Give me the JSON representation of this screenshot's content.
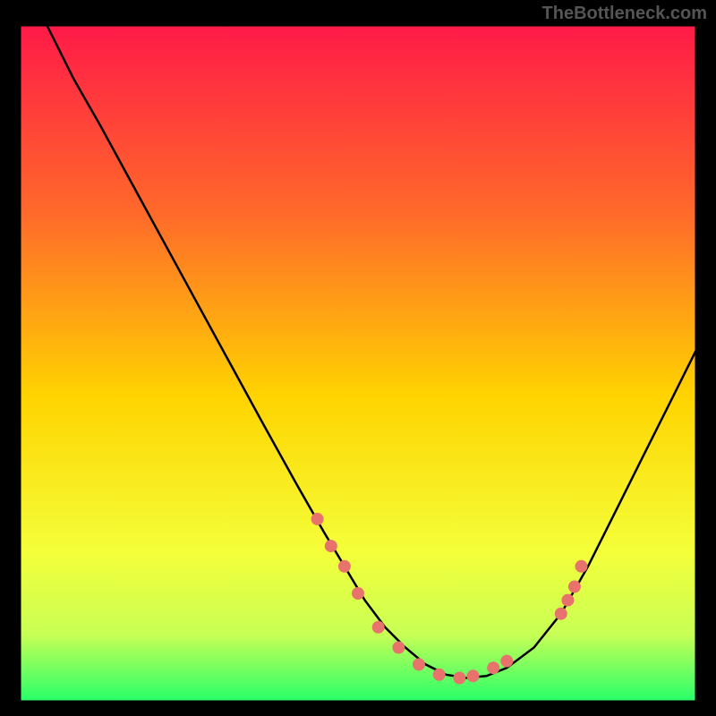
{
  "watermark": "TheBottleneck.com",
  "chart_data": {
    "type": "line",
    "title": "",
    "xlabel": "",
    "ylabel": "",
    "xlim": [
      0,
      100
    ],
    "ylim": [
      0,
      100
    ],
    "grid": false,
    "legend": false,
    "background_gradient": {
      "top": "#ff1a48",
      "mid": "#ffe600",
      "bottom": "#26ff6a"
    },
    "series": [
      {
        "name": "curve",
        "color": "#000000",
        "x": [
          4,
          5,
          8,
          12,
          18,
          24,
          30,
          36,
          41,
          45,
          48,
          51,
          54,
          57,
          60,
          63,
          66,
          69,
          72,
          76,
          80,
          84,
          88,
          92,
          96,
          100
        ],
        "y": [
          100,
          98,
          92,
          85,
          74,
          63,
          52,
          41,
          32,
          25,
          20,
          15,
          11,
          8,
          5.5,
          4,
          3.5,
          3.8,
          5,
          8,
          13,
          20,
          28,
          36,
          44,
          52
        ]
      }
    ],
    "scatter_points": {
      "name": "highlighted-points",
      "color": "#e8736c",
      "x": [
        44,
        46,
        48,
        50,
        53,
        56,
        59,
        62,
        65,
        67,
        70,
        72,
        80,
        81,
        82,
        83
      ],
      "y": [
        27,
        23,
        20,
        16,
        11,
        8,
        5.5,
        4,
        3.5,
        3.8,
        5,
        6,
        13,
        15,
        17,
        20
      ]
    }
  }
}
